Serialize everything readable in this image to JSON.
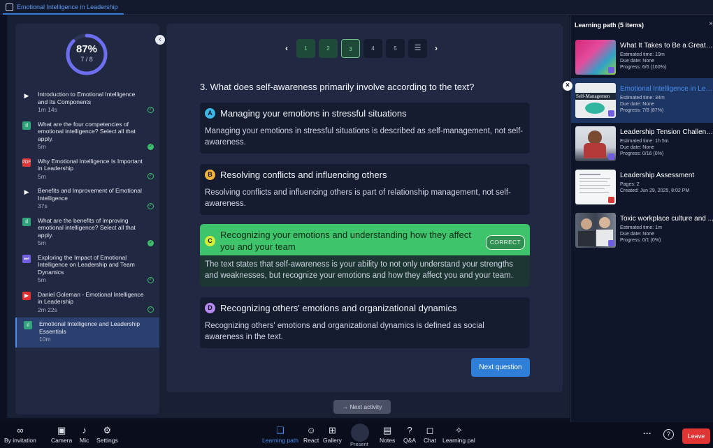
{
  "tab": {
    "title": "Emotional Intelligence in Leadership"
  },
  "progress": {
    "percent": "87%",
    "fraction": "7 / 8",
    "value": 0.875
  },
  "sidebar": {
    "items": [
      {
        "title": "Introduction to Emotional Intelligence and Its Components",
        "meta": "1m 14s",
        "icon": "video-icon",
        "status": "done-outline"
      },
      {
        "title": "What are the four competencies of emotional intelligence? Select all that apply.",
        "meta": "5m",
        "icon": "quiz-icon",
        "status": "done-filled"
      },
      {
        "title": "Why Emotional Intelligence Is Important in Leadership",
        "meta": "5m",
        "icon": "pdf-icon",
        "status": "done-outline"
      },
      {
        "title": "Benefits and Improvement of Emotional Intelligence",
        "meta": "37s",
        "icon": "video-icon",
        "status": "done-outline"
      },
      {
        "title": "What are the benefits of improving emotional intelligence? Select all that apply.",
        "meta": "5m",
        "icon": "quiz-icon",
        "status": "done-filled"
      },
      {
        "title": "Exploring the Impact of Emotional Intelligence on Leadership and Team Dynamics",
        "meta": "5m",
        "icon": "scorm-icon",
        "status": "done-outline"
      },
      {
        "title": "Daniel Goleman - Emotional Intelligence in Leadership",
        "meta": "2m 22s",
        "icon": "youtube-icon",
        "status": "done-outline"
      },
      {
        "title": "Emotional Intelligence and Leadership Essentials",
        "meta": "10m",
        "icon": "quiz-icon",
        "status": "active"
      }
    ]
  },
  "pager": {
    "pages": [
      "1",
      "2",
      "3",
      "4",
      "5"
    ],
    "current": 3
  },
  "quiz": {
    "question": "3. What does self-awareness primarily involve according to the text?",
    "options": [
      {
        "letter": "A",
        "color": "#3ab7e6",
        "text": "Managing your emotions in stressful situations",
        "explanation": "Managing your emotions in stressful situations is described as self-management, not self-awareness."
      },
      {
        "letter": "B",
        "color": "#f2b33a",
        "text": "Resolving conflicts and influencing others",
        "explanation": "Resolving conflicts and influencing others is part of relationship management, not self-awareness."
      },
      {
        "letter": "C",
        "color": "#d6ee3a",
        "text": "Recognizing your emotions and understanding how they affect you and your team",
        "explanation": "The text states that self-awareness is your ability to not only understand your strengths and weaknesses, but recognize your emotions and how they affect you and your team.",
        "badge": "CORRECT"
      },
      {
        "letter": "D",
        "color": "#b689f0",
        "text": "Recognizing others' emotions and organizational dynamics",
        "explanation": "Recognizing others' emotions and organizational dynamics is defined as social awareness in the text."
      }
    ],
    "next_question": "Next question"
  },
  "next_activity": "→  Next activity",
  "learning_path": {
    "title": "Learning path (5 items)",
    "items": [
      {
        "name": "What It Takes to Be a Great L...",
        "l1": "Estimated time:  19m",
        "l2": "Due date:  None",
        "l3": "Progress:  6/6 (100%)"
      },
      {
        "name": "Emotional Intelligence in Lea...",
        "l1": "Estimated time:  34m",
        "l2": "Due date:  None",
        "l3": "Progress:  7/8 (87%)",
        "thumb_text": "Self-Managemen"
      },
      {
        "name": "Leadership Tension Challenges",
        "l1": "Estimated time:  1h 5m",
        "l2": "Due date:  None",
        "l3": "Progress:  0/16 (0%)"
      },
      {
        "name": "Leadership Assessment",
        "l1": "Pages:  2",
        "l2": "Created:  Jun 29, 2025, 8:02 PM",
        "l3": ""
      },
      {
        "name": "Toxic workplace culture and ...",
        "l1": "Estimated time:  1m",
        "l2": "Due date:  None",
        "l3": "Progress:  0/1 (0%)"
      }
    ]
  },
  "toolbar": {
    "invite": "By invitation",
    "camera": "Camera",
    "mic": "Mic",
    "settings": "Settings",
    "learning_path": "Learning path",
    "react": "React",
    "gallery": "Gallery",
    "present": "Present",
    "notes": "Notes",
    "qa": "Q&A",
    "chat": "Chat",
    "learning_pal": "Learning pal",
    "more": "···",
    "help": "?",
    "leave": "Leave"
  }
}
